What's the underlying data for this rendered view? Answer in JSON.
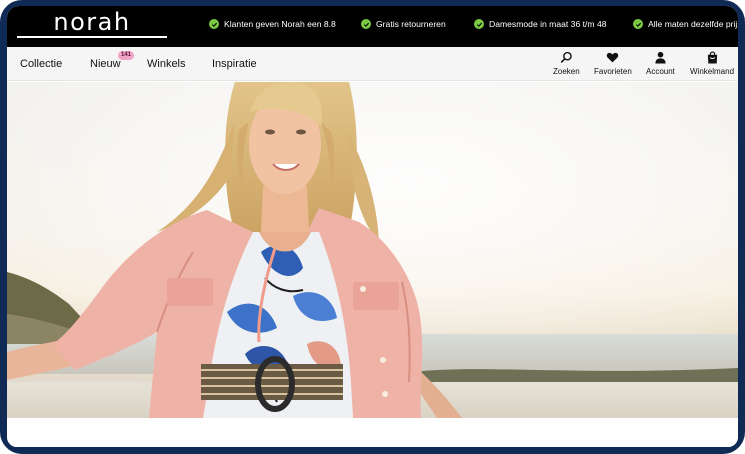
{
  "brand": {
    "logo": "norah"
  },
  "usps": [
    {
      "icon": "check-circle-icon",
      "text": "Klanten geven Norah een 8.8"
    },
    {
      "icon": "check-circle-icon",
      "text": "Gratis retourneren"
    },
    {
      "icon": "check-circle-icon",
      "text": "Damesmode in maat 36 t/m 48"
    },
    {
      "icon": "check-circle-icon",
      "text": "Alle maten dezelfde prijs"
    }
  ],
  "nav": {
    "items": [
      {
        "label": "Collectie"
      },
      {
        "label": "Nieuw",
        "badge": "141"
      },
      {
        "label": "Winkels"
      },
      {
        "label": "Inspiratie"
      }
    ]
  },
  "utility": {
    "search": {
      "label": "Zoeken",
      "icon": "search-icon"
    },
    "favorites": {
      "label": "Favorieten",
      "icon": "heart-icon"
    },
    "account": {
      "label": "Account",
      "icon": "user-icon"
    },
    "cart": {
      "label": "Winkelmand",
      "icon": "shopping-bag-icon"
    }
  },
  "colors": {
    "topbar": "#000000",
    "check": "#7ac943",
    "badge": "#f2a3c8",
    "navbar": "#f5f5f5"
  }
}
